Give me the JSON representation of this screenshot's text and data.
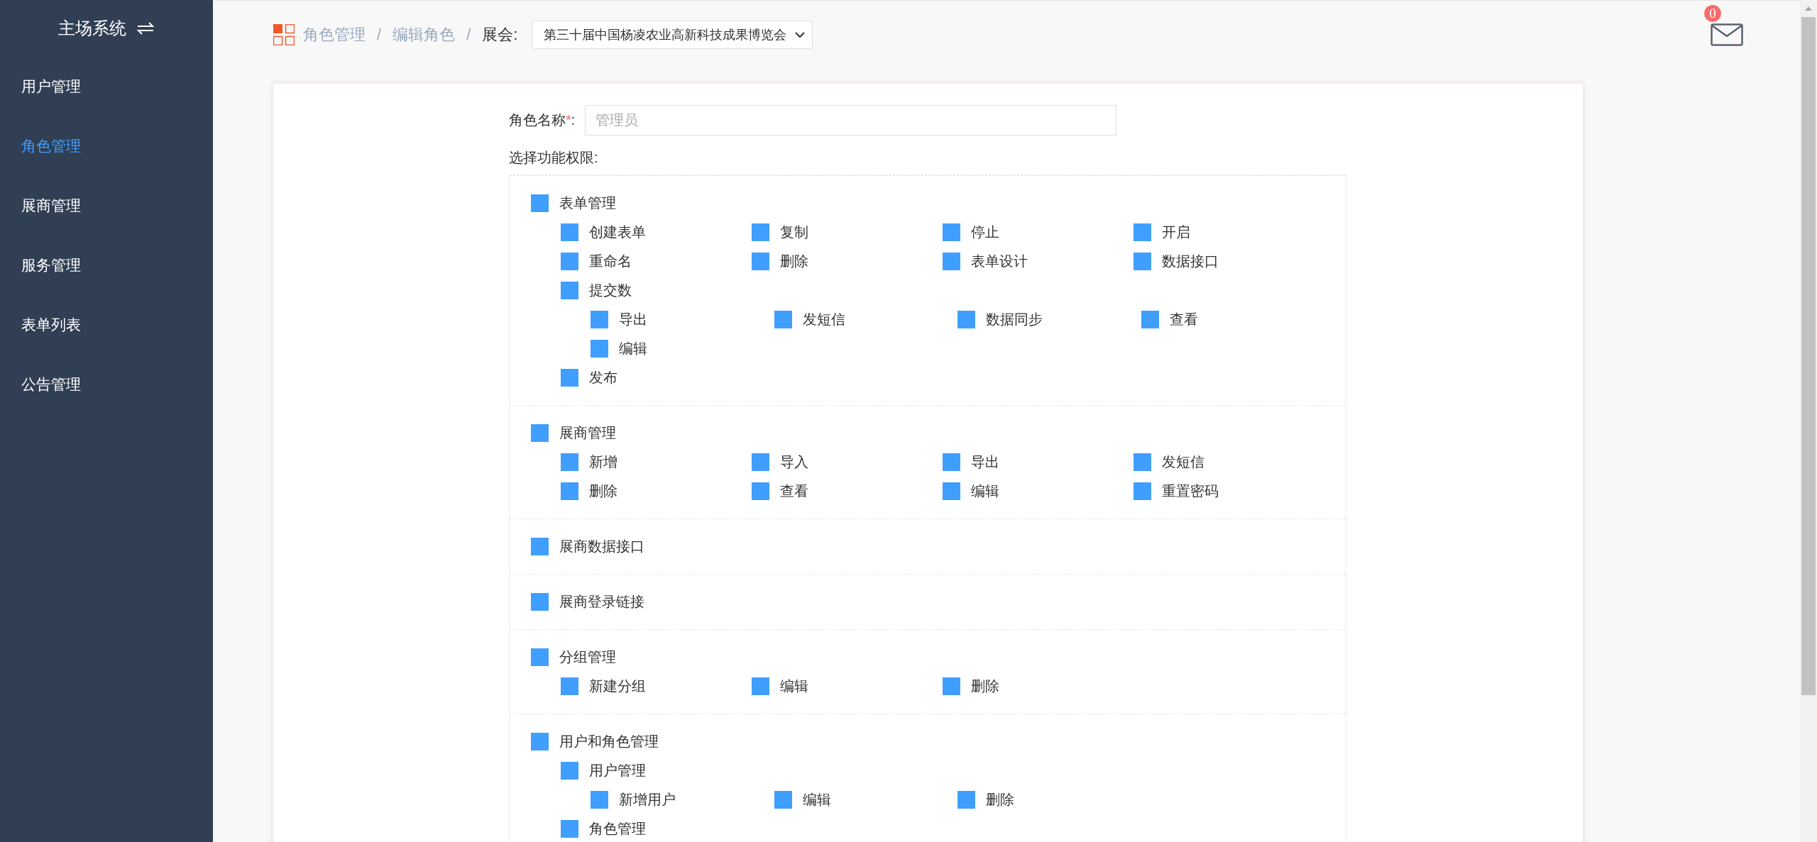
{
  "sidebar": {
    "title": "主场系统",
    "items": [
      {
        "label": "用户管理",
        "selected": false
      },
      {
        "label": "角色管理",
        "selected": true
      },
      {
        "label": "展商管理",
        "selected": false
      },
      {
        "label": "服务管理",
        "selected": false
      },
      {
        "label": "表单列表",
        "selected": false
      },
      {
        "label": "公告管理",
        "selected": false
      }
    ]
  },
  "breadcrumb": [
    "角色管理",
    "编辑角色"
  ],
  "breadcrumb_separator": "/",
  "exhibition": {
    "label": "展会:",
    "value": "第三十届中国杨凌农业高新科技成果博览会"
  },
  "mail_badge": "0",
  "form": {
    "name_label": "角色名称",
    "required_mark": "*",
    "name_colon": ":",
    "name_placeholder": "管理员",
    "permissions_label": "选择功能权限:"
  },
  "permissions": [
    {
      "label": "表单管理",
      "checked": true,
      "children": [
        {
          "label": "创建表单",
          "checked": true
        },
        {
          "label": "复制",
          "checked": true
        },
        {
          "label": "停止",
          "checked": true
        },
        {
          "label": "开启",
          "checked": true
        },
        {
          "label": "重命名",
          "checked": true
        },
        {
          "label": "删除",
          "checked": true
        },
        {
          "label": "表单设计",
          "checked": true
        },
        {
          "label": "数据接口",
          "checked": true
        },
        {
          "label": "提交数",
          "checked": true,
          "children": [
            {
              "label": "导出",
              "checked": true
            },
            {
              "label": "发短信",
              "checked": true
            },
            {
              "label": "数据同步",
              "checked": true
            },
            {
              "label": "查看",
              "checked": true
            },
            {
              "label": "编辑",
              "checked": true
            }
          ]
        },
        {
          "label": "发布",
          "checked": true
        }
      ]
    },
    {
      "label": "展商管理",
      "checked": true,
      "children": [
        {
          "label": "新增",
          "checked": true
        },
        {
          "label": "导入",
          "checked": true
        },
        {
          "label": "导出",
          "checked": true
        },
        {
          "label": "发短信",
          "checked": true
        },
        {
          "label": "删除",
          "checked": true
        },
        {
          "label": "查看",
          "checked": true
        },
        {
          "label": "编辑",
          "checked": true
        },
        {
          "label": "重置密码",
          "checked": true
        }
      ]
    },
    {
      "label": "展商数据接口",
      "checked": true
    },
    {
      "label": "展商登录链接",
      "checked": true
    },
    {
      "label": "分组管理",
      "checked": true,
      "children": [
        {
          "label": "新建分组",
          "checked": true
        },
        {
          "label": "编辑",
          "checked": true
        },
        {
          "label": "删除",
          "checked": true
        }
      ]
    },
    {
      "label": "用户和角色管理",
      "checked": true,
      "children": [
        {
          "label": "用户管理",
          "checked": true,
          "children": [
            {
              "label": "新增用户",
              "checked": true
            },
            {
              "label": "编辑",
              "checked": true
            },
            {
              "label": "删除",
              "checked": true
            }
          ]
        },
        {
          "label": "角色管理",
          "checked": true
        }
      ]
    }
  ]
}
